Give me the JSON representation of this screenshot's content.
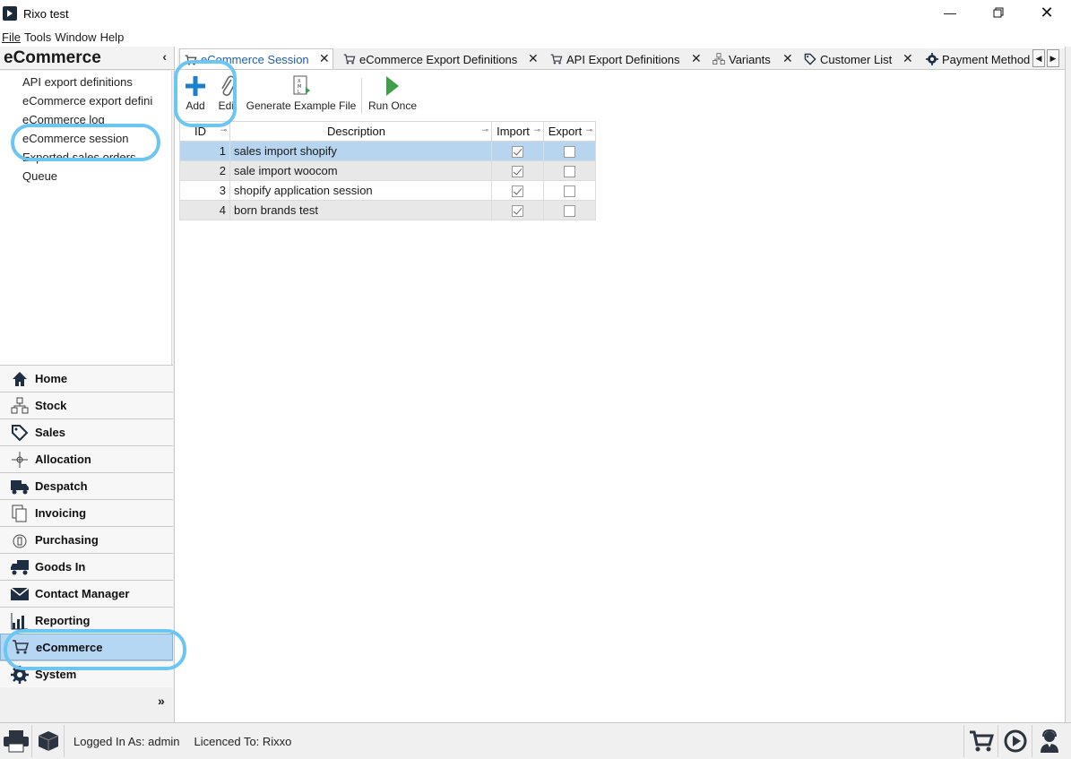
{
  "window": {
    "title": "Rixo test",
    "controls": [
      "minimize-icon",
      "restore-icon",
      "close-icon"
    ]
  },
  "menu": {
    "items": [
      {
        "label": "File"
      },
      {
        "label": "Tools"
      },
      {
        "label": "Window"
      },
      {
        "label": "Help"
      }
    ]
  },
  "sidebar": {
    "header": "eCommerce",
    "tree_items": [
      {
        "label": "API export definitions"
      },
      {
        "label": "eCommerce export defini"
      },
      {
        "label": "eCommerce log"
      },
      {
        "label": "eCommerce session"
      },
      {
        "label": "Exported sales orders"
      },
      {
        "label": "Queue"
      }
    ],
    "nav_items": [
      {
        "label": "Home",
        "icon": "home-icon"
      },
      {
        "label": "Stock",
        "icon": "stock-icon"
      },
      {
        "label": "Sales",
        "icon": "sales-tag-icon"
      },
      {
        "label": "Allocation",
        "icon": "allocation-icon"
      },
      {
        "label": "Despatch",
        "icon": "truck-icon"
      },
      {
        "label": "Invoicing",
        "icon": "invoice-icon"
      },
      {
        "label": "Purchasing",
        "icon": "purchasing-icon"
      },
      {
        "label": "Goods In",
        "icon": "goods-in-icon"
      },
      {
        "label": "Contact Manager",
        "icon": "envelope-icon"
      },
      {
        "label": "Reporting",
        "icon": "chart-icon"
      },
      {
        "label": "eCommerce",
        "icon": "cart-icon",
        "active": true
      },
      {
        "label": "System",
        "icon": "gear-icon"
      }
    ],
    "more": "»"
  },
  "tabs": [
    {
      "label": "eCommerce Session",
      "active": true
    },
    {
      "label": "eCommerce Export Definitions"
    },
    {
      "label": "API Export Definitions"
    },
    {
      "label": "Variants"
    },
    {
      "label": "Customer List"
    },
    {
      "label": "Payment Method"
    }
  ],
  "toolbar": {
    "add": "Add",
    "edit": "Edit",
    "generate": "Generate Example File",
    "run": "Run Once"
  },
  "grid": {
    "columns": {
      "id": "ID",
      "description": "Description",
      "import": "Import",
      "export": "Export"
    },
    "rows": [
      {
        "id": "1",
        "description": "sales import shopify",
        "import": true,
        "export": false
      },
      {
        "id": "2",
        "description": "sale import woocom",
        "import": true,
        "export": false
      },
      {
        "id": "3",
        "description": "shopify application session",
        "import": true,
        "export": false
      },
      {
        "id": "4",
        "description": "born brands test",
        "import": true,
        "export": false
      }
    ]
  },
  "status": {
    "logged_in": "Logged In As: admin",
    "licence": "Licenced To: Rixxo"
  },
  "colors": {
    "highlight": "#6cc6f3",
    "selection": "#b7d5ee",
    "accent_green": "#3aa04a",
    "accent_blue": "#1b7fd1"
  }
}
